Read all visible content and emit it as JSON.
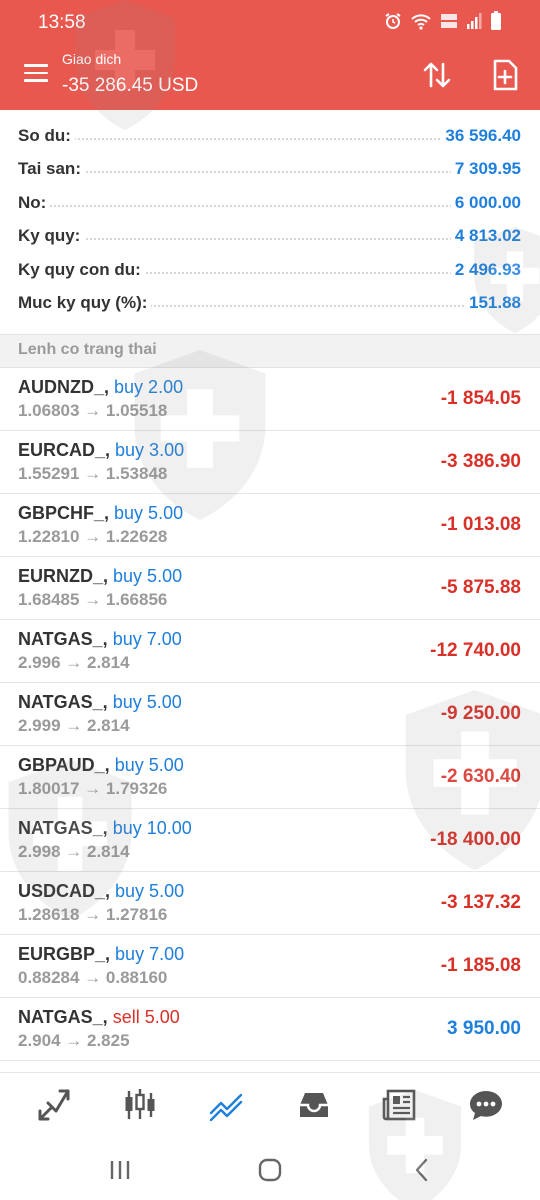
{
  "status": {
    "time": "13:58"
  },
  "header": {
    "title": "Giao dich",
    "balance": "-35 286.45 USD"
  },
  "summary": [
    {
      "label": "So du:",
      "value": "36 596.40"
    },
    {
      "label": "Tai san:",
      "value": "7 309.95"
    },
    {
      "label": "No:",
      "value": "6 000.00"
    },
    {
      "label": "Ky quy:",
      "value": "4 813.02"
    },
    {
      "label": "Ky quy con du:",
      "value": "2 496.93"
    },
    {
      "label": "Muc ky quy (%):",
      "value": "151.88"
    }
  ],
  "section_title": "Lenh co trang thai",
  "orders": [
    {
      "symbol": "AUDNZD_,",
      "side": "buy 2.00",
      "prices": "1.06803 → 1.05518",
      "profit": "-1 854.05"
    },
    {
      "symbol": "EURCAD_,",
      "side": "buy 3.00",
      "prices": "1.55291 → 1.53848",
      "profit": "-3 386.90"
    },
    {
      "symbol": "GBPCHF_,",
      "side": "buy 5.00",
      "prices": "1.22810 → 1.22628",
      "profit": "-1 013.08"
    },
    {
      "symbol": "EURNZD_,",
      "side": "buy 5.00",
      "prices": "1.68485 → 1.66856",
      "profit": "-5 875.88"
    },
    {
      "symbol": "NATGAS_,",
      "side": "buy 7.00",
      "prices": "2.996 → 2.814",
      "profit": "-12 740.00"
    },
    {
      "symbol": "NATGAS_,",
      "side": "buy 5.00",
      "prices": "2.999 → 2.814",
      "profit": "-9 250.00"
    },
    {
      "symbol": "GBPAUD_,",
      "side": "buy 5.00",
      "prices": "1.80017 → 1.79326",
      "profit": "-2 630.40"
    },
    {
      "symbol": "NATGAS_,",
      "side": "buy 10.00",
      "prices": "2.998 → 2.814",
      "profit": "-18 400.00"
    },
    {
      "symbol": "USDCAD_,",
      "side": "buy 5.00",
      "prices": "1.28618 → 1.27816",
      "profit": "-3 137.32"
    },
    {
      "symbol": "EURGBP_,",
      "side": "buy 7.00",
      "prices": "0.88284 → 0.88160",
      "profit": "-1 185.08"
    },
    {
      "symbol": "NATGAS_,",
      "side": "sell 5.00",
      "prices": "2.904 → 2.825",
      "profit": "3 950.00"
    }
  ],
  "bottom_nav": [
    {
      "icon": "quotes-icon"
    },
    {
      "icon": "chart-icon"
    },
    {
      "icon": "trade-icon",
      "active": true
    },
    {
      "icon": "history-icon"
    },
    {
      "icon": "news-icon"
    },
    {
      "icon": "messages-icon"
    }
  ],
  "colors": {
    "header": "#e8584f",
    "blue": "#1f7fdc",
    "red": "#d93028",
    "active_nav": "#1f7fdc"
  }
}
